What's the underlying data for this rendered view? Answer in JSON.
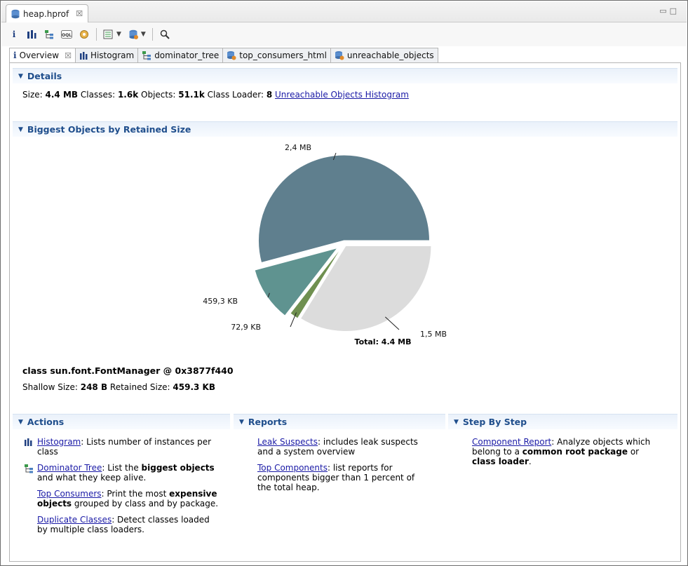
{
  "editor_tab": {
    "title": "heap.hprof",
    "close": "☒"
  },
  "inner_tabs": [
    {
      "label": "Overview",
      "close": "☒"
    },
    {
      "label": "Histogram"
    },
    {
      "label": "dominator_tree"
    },
    {
      "label": "top_consumers_html"
    },
    {
      "label": "unreachable_objects"
    }
  ],
  "details": {
    "header": "Details",
    "size_label": "Size:",
    "size_value": "4.4 MB",
    "classes_label": "Classes:",
    "classes_value": "1.6k",
    "objects_label": "Objects:",
    "objects_value": "51.1k",
    "loader_label": "Class Loader:",
    "loader_value": "8",
    "link": "Unreachable Objects Histogram"
  },
  "biggest": {
    "header": "Biggest Objects by Retained Size",
    "object_class": "class sun.font.FontManager @ 0x3877f440",
    "shallow_label": "Shallow Size:",
    "shallow_value": "248 B",
    "retained_label": "Retained Size:",
    "retained_value": "459.3 KB"
  },
  "chart_data": {
    "type": "pie",
    "title": "",
    "total_label": "Total: 4.4 MB",
    "slices": [
      {
        "label": "2,4 MB",
        "value": 2.4,
        "color": "#5f7f8e",
        "exploded": false
      },
      {
        "label": "459,3 KB",
        "value": 0.4593,
        "color": "#5f9390",
        "exploded": true
      },
      {
        "label": "72,9 KB",
        "value": 0.0729,
        "color": "#6f9050",
        "exploded": false
      },
      {
        "label": "1,5 MB",
        "value": 1.5,
        "color": "#dcdcdc",
        "exploded": false
      }
    ]
  },
  "actions": {
    "header": "Actions",
    "items": [
      {
        "link": "Histogram",
        "text": ": Lists number of instances per class",
        "icon": "histogram-icon"
      },
      {
        "link": "Dominator Tree",
        "pre": ": List the ",
        "bold": "biggest objects",
        "post": " and what they keep alive.",
        "icon": "dominator-tree-icon"
      },
      {
        "link": "Top Consumers",
        "pre": ": Print the most ",
        "bold": "expensive objects",
        "post": " grouped by class and by package."
      },
      {
        "link": "Duplicate Classes",
        "text": ": Detect classes loaded by multiple class loaders."
      }
    ]
  },
  "reports": {
    "header": "Reports",
    "items": [
      {
        "link": "Leak Suspects",
        "text": ": includes leak suspects and a system overview"
      },
      {
        "link": "Top Components",
        "text": ": list reports for components bigger than 1 percent of the total heap."
      }
    ]
  },
  "step_by_step": {
    "header": "Step By Step",
    "link": "Component Report",
    "pre": ": Analyze objects which belong to a ",
    "bold1": "common root package",
    "mid": " or ",
    "bold2": "class loader",
    "post": "."
  }
}
